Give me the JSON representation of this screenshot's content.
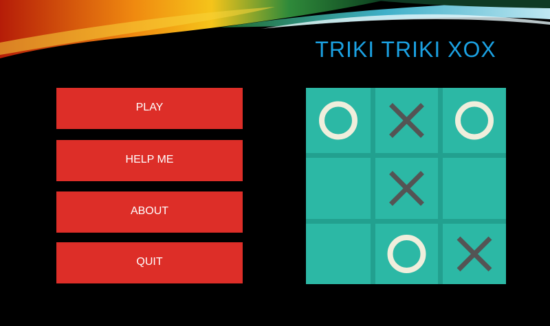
{
  "window": {
    "title": "TRIKI TRIKI XOX"
  },
  "menu": {
    "items": [
      {
        "id": "play",
        "label": "PLAY"
      },
      {
        "id": "help",
        "label": "HELP ME"
      },
      {
        "id": "about",
        "label": "ABOUT"
      },
      {
        "id": "quit",
        "label": "QUIT"
      }
    ]
  },
  "board": {
    "cells": [
      [
        "O",
        "X",
        "O"
      ],
      [
        "",
        "X",
        ""
      ],
      [
        "",
        "O",
        "X"
      ]
    ]
  },
  "colors": {
    "background": "#000000",
    "title": "#1ba1e2",
    "button": "#dd2e28",
    "board": "#2cb8a5",
    "grid_line": "#22a08f",
    "x_mark": "#545454",
    "o_mark": "#f0eedc"
  },
  "icons": {
    "x_mark": "x-mark-icon",
    "o_mark": "o-mark-icon"
  }
}
